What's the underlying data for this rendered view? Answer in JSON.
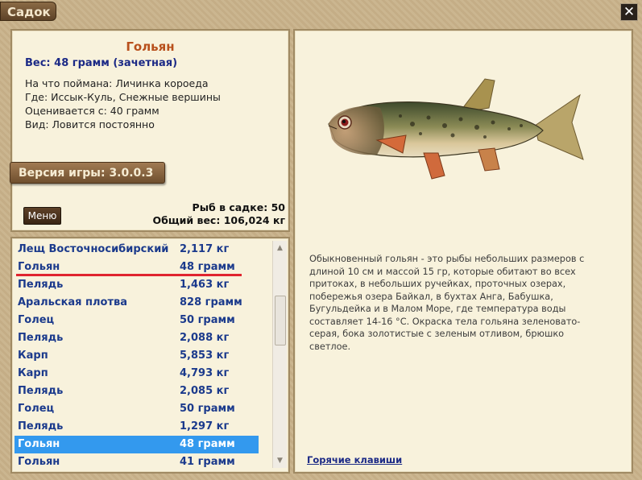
{
  "window": {
    "title": "Садок",
    "close_glyph": "✕"
  },
  "info": {
    "fish_name": "Гольян",
    "weight_line": "Вес: 48 грамм (зачетная)",
    "caught_on": "На что поймана: Личинка короеда",
    "location": "Где: Иссык-Куль, Снежные вершины",
    "valued_from": "Оценивается с: 40 грамм",
    "kind": "Вид: Ловится постоянно",
    "version": "Версия игры: 3.0.0.3",
    "menu_label": "Меню",
    "fish_count": "Рыб в садке: 50",
    "total_weight": "Общий вес: 106,024 кг"
  },
  "list": {
    "rows": [
      {
        "name": "Лещ Восточносибирский",
        "weight": "2,117 кг"
      },
      {
        "name": "Гольян",
        "weight": "48 грамм"
      },
      {
        "name": "Пелядь",
        "weight": "1,463 кг"
      },
      {
        "name": "Аральская плотва",
        "weight": "828 грамм"
      },
      {
        "name": "Голец",
        "weight": "50 грамм"
      },
      {
        "name": "Пелядь",
        "weight": "2,088 кг"
      },
      {
        "name": "Карп",
        "weight": "5,853 кг"
      },
      {
        "name": "Карп",
        "weight": "4,793 кг"
      },
      {
        "name": "Пелядь",
        "weight": "2,085 кг"
      },
      {
        "name": "Голец",
        "weight": "50 грамм"
      },
      {
        "name": "Пелядь",
        "weight": "1,297 кг"
      },
      {
        "name": "Гольян",
        "weight": "48 грамм"
      },
      {
        "name": "Гольян",
        "weight": "41 грамм"
      }
    ],
    "selected_index": 11,
    "marked_index": 1
  },
  "description": {
    "text": "Обыкновенный гольян - это рыбы небольших размеров с длиной 10 см и массой 15 гр, которые обитают во всех притоках, в небольших ручейках, проточных озерах, побережья озера Байкал, в бухтах Анга, Бабушка, Бугульдейка и в Малом Море, где температура воды составляет 14-16 °C. Окраска тела гольяна зеленовато-серая, бока золотистые с зеленым отливом, брюшко светлое.",
    "hotkeys_link": "Горячие клавиши"
  },
  "colors": {
    "fish_name": "#b8501c",
    "accent_blue": "#1c2a86",
    "selection": "#3399ee",
    "mark_red": "#e0242e"
  }
}
